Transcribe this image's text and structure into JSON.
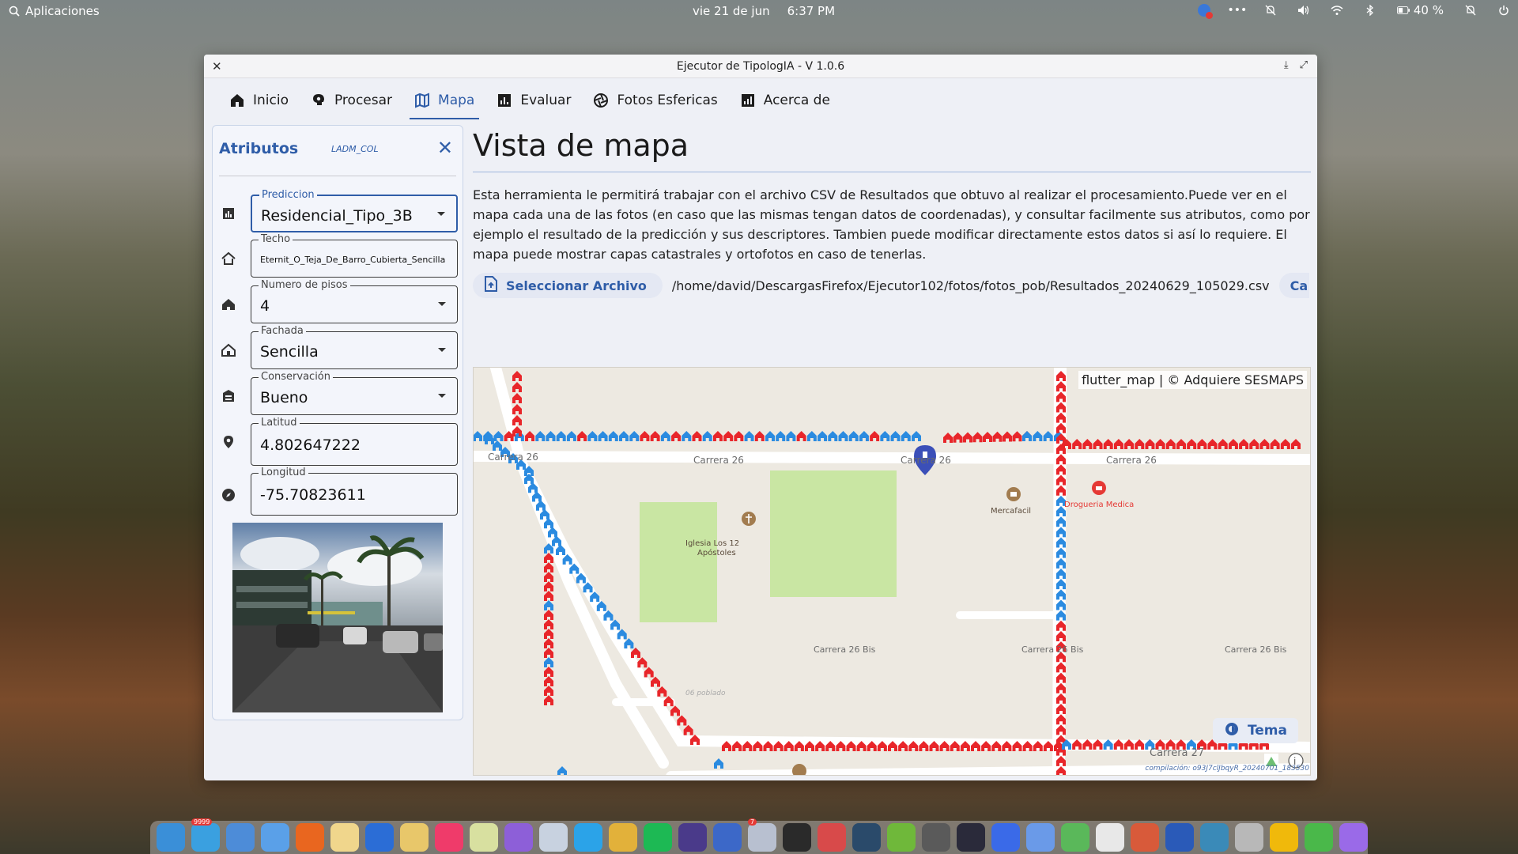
{
  "topbar": {
    "apps_label": "Aplicaciones",
    "date": "vie 21 de jun",
    "time": "6:37 PM",
    "battery": "40 %"
  },
  "window": {
    "title": "Ejecutor de TipologIA - V 1.0.6"
  },
  "tabs": [
    {
      "label": "Inicio",
      "icon": "home-icon",
      "active": false
    },
    {
      "label": "Procesar",
      "icon": "brain-icon",
      "active": false
    },
    {
      "label": "Mapa",
      "icon": "map-icon",
      "active": true
    },
    {
      "label": "Evaluar",
      "icon": "bar-chart-icon",
      "active": false
    },
    {
      "label": "Fotos Esfericas",
      "icon": "aperture-icon",
      "active": false
    },
    {
      "label": "Acerca de",
      "icon": "analytics-icon",
      "active": false
    }
  ],
  "attributes": {
    "title": "Atributos",
    "subtitle": "LADM_COL",
    "fields": [
      {
        "label": "Prediccion",
        "value": "Residencial_Tipo_3B",
        "type": "dropdown",
        "icon": "chart-icon"
      },
      {
        "label": "Techo",
        "value": "Eternit_O_Teja_De_Barro_Cubierta_Sencilla",
        "type": "text",
        "icon": "roof-icon"
      },
      {
        "label": "Numero de pisos",
        "value": "4",
        "type": "dropdown",
        "icon": "house-icon"
      },
      {
        "label": "Fachada",
        "value": "Sencilla",
        "type": "dropdown",
        "icon": "facade-icon"
      },
      {
        "label": "Conservación",
        "value": "Bueno",
        "type": "dropdown",
        "icon": "shield-icon"
      },
      {
        "label": "Latitud",
        "value": "4.802647222",
        "type": "text",
        "icon": "location-pin-icon"
      },
      {
        "label": "Longitud",
        "value": "-75.70823611",
        "type": "text",
        "icon": "compass-icon"
      }
    ]
  },
  "main": {
    "title": "Vista de mapa",
    "description": "Esta herramienta le permitirá trabajar con el archivo CSV de Resultados que obtuvo al realizar el procesamiento.Puede ver en el mapa cada una de las fotos (en caso que las mismas tengan datos de coordenadas), y consultar facilmente sus atributos, como por ejemplo el resultado de la predicción y sus descriptores. Tambien puede modificar directamente estos datos si así lo requiere. El mapa puede mostrar capas catastrales y ortofotos en caso de tenerlas.",
    "select_button": "Seleccionar Archivo",
    "file_path": "/home/david/DescargasFirefox/Ejecutor102/fotos/fotos_pob/Resultados_20240629_105029.csv",
    "cut_button": "Ca"
  },
  "map": {
    "attribution": "flutter_map | © Adquiere SESMAPS",
    "labels": {
      "carrera26_a": "Carrera 26",
      "carrera26_b": "Carrera 26",
      "carrera26_c": "Carrera 26",
      "carrera26_d": "Carrera 26",
      "carrera26bis_a": "Carrera 26 Bis",
      "carrera26bis_b": "Carrera 26 Bis",
      "carrera26bis_c": "Carrera 26 Bis",
      "carrera27": "Carrera 27",
      "poi_church": "Iglesia Los 12 Apóstoles",
      "poi_church_1": "Iglesia Los 12",
      "poi_church_2": "Apóstoles",
      "poi_mercafacil": "Mercafacil",
      "poi_drogueria": "Drogueria Medica",
      "poi_poblado": "06 poblado"
    },
    "colors": {
      "blue_marker": "#2b8be0",
      "red_marker": "#e8262a",
      "selected_pin": "#3b4fb8",
      "park": "#c9e6a3"
    }
  },
  "footer": {
    "theme_button": "Tema",
    "build": "compilación: o93J7clJbqyR_20240701_183530"
  },
  "dock": {
    "badges": [
      "9999",
      "7"
    ]
  }
}
